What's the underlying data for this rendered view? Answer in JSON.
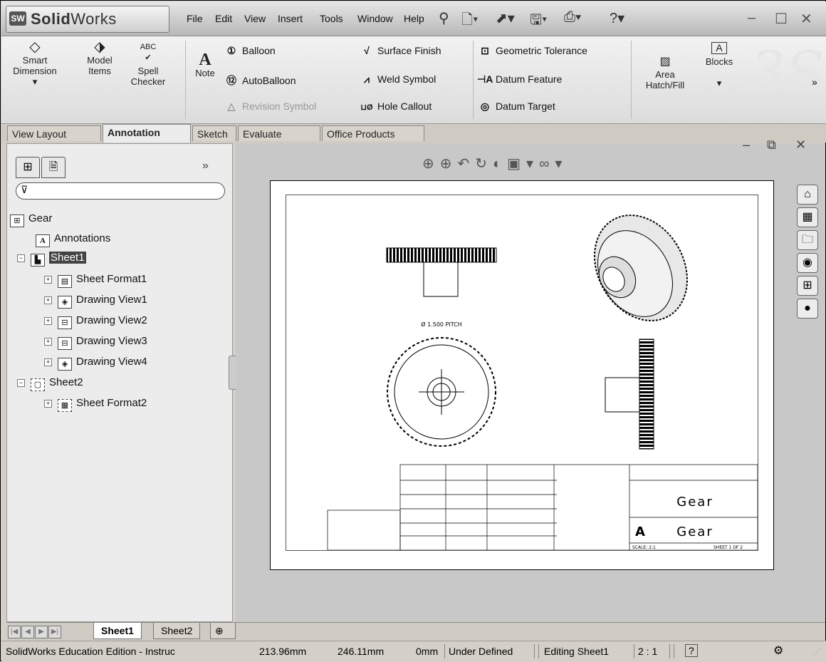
{
  "app": {
    "logo_badge": "SW",
    "logo_bold": "Solid",
    "logo_light": "Works"
  },
  "menu": [
    "File",
    "Edit",
    "View",
    "Insert",
    "Tools",
    "Window",
    "Help"
  ],
  "ribbon": {
    "smart_dimension": [
      "Smart",
      "Dimension"
    ],
    "model_items": [
      "Model",
      "Items"
    ],
    "spell_checker": [
      "Spell",
      "Checker"
    ],
    "note": "Note",
    "balloon": "Balloon",
    "autoballoon": "AutoBalloon",
    "revision_symbol": "Revision Symbol",
    "surface_finish": "Surface Finish",
    "weld_symbol": "Weld Symbol",
    "hole_callout": "Hole Callout",
    "geometric_tolerance": "Geometric Tolerance",
    "datum_feature": "Datum Feature",
    "datum_target": "Datum Target",
    "area_hatch": [
      "Area",
      "Hatch/Fill"
    ],
    "blocks": "Blocks",
    "spell_icon_text": "ABC"
  },
  "command_tabs": [
    "View Layout",
    "Annotation",
    "Sketch",
    "Evaluate",
    "Office Products"
  ],
  "tree": {
    "root": "Gear",
    "annotations": "Annotations",
    "sheet1": "Sheet1",
    "sheet_format1": "Sheet Format1",
    "views": [
      "Drawing View1",
      "Drawing View2",
      "Drawing View3",
      "Drawing View4"
    ],
    "sheet2": "Sheet2",
    "sheet_format2": "Sheet Format2"
  },
  "drawing": {
    "pitch_label": "Ø 1.500 PITCH",
    "title": "Gear",
    "dwg_no": "Gear",
    "size": "A",
    "scale": "SCALE: 2:1",
    "sheet": "SHEET 1 OF 2"
  },
  "sheet_tabs": [
    "Sheet1",
    "Sheet2"
  ],
  "status": {
    "product": "SolidWorks Education Edition - Instruc",
    "x": "213.96mm",
    "y": "246.11mm",
    "z": "0mm",
    "state": "Under Defined",
    "editing": "Editing Sheet1",
    "scale": "2 : 1",
    "help": "?"
  },
  "colors": {
    "window_bg": "#d4d0c8",
    "sheet_bg": "#ffffff",
    "graphics_bg": "#c8c8c8"
  }
}
